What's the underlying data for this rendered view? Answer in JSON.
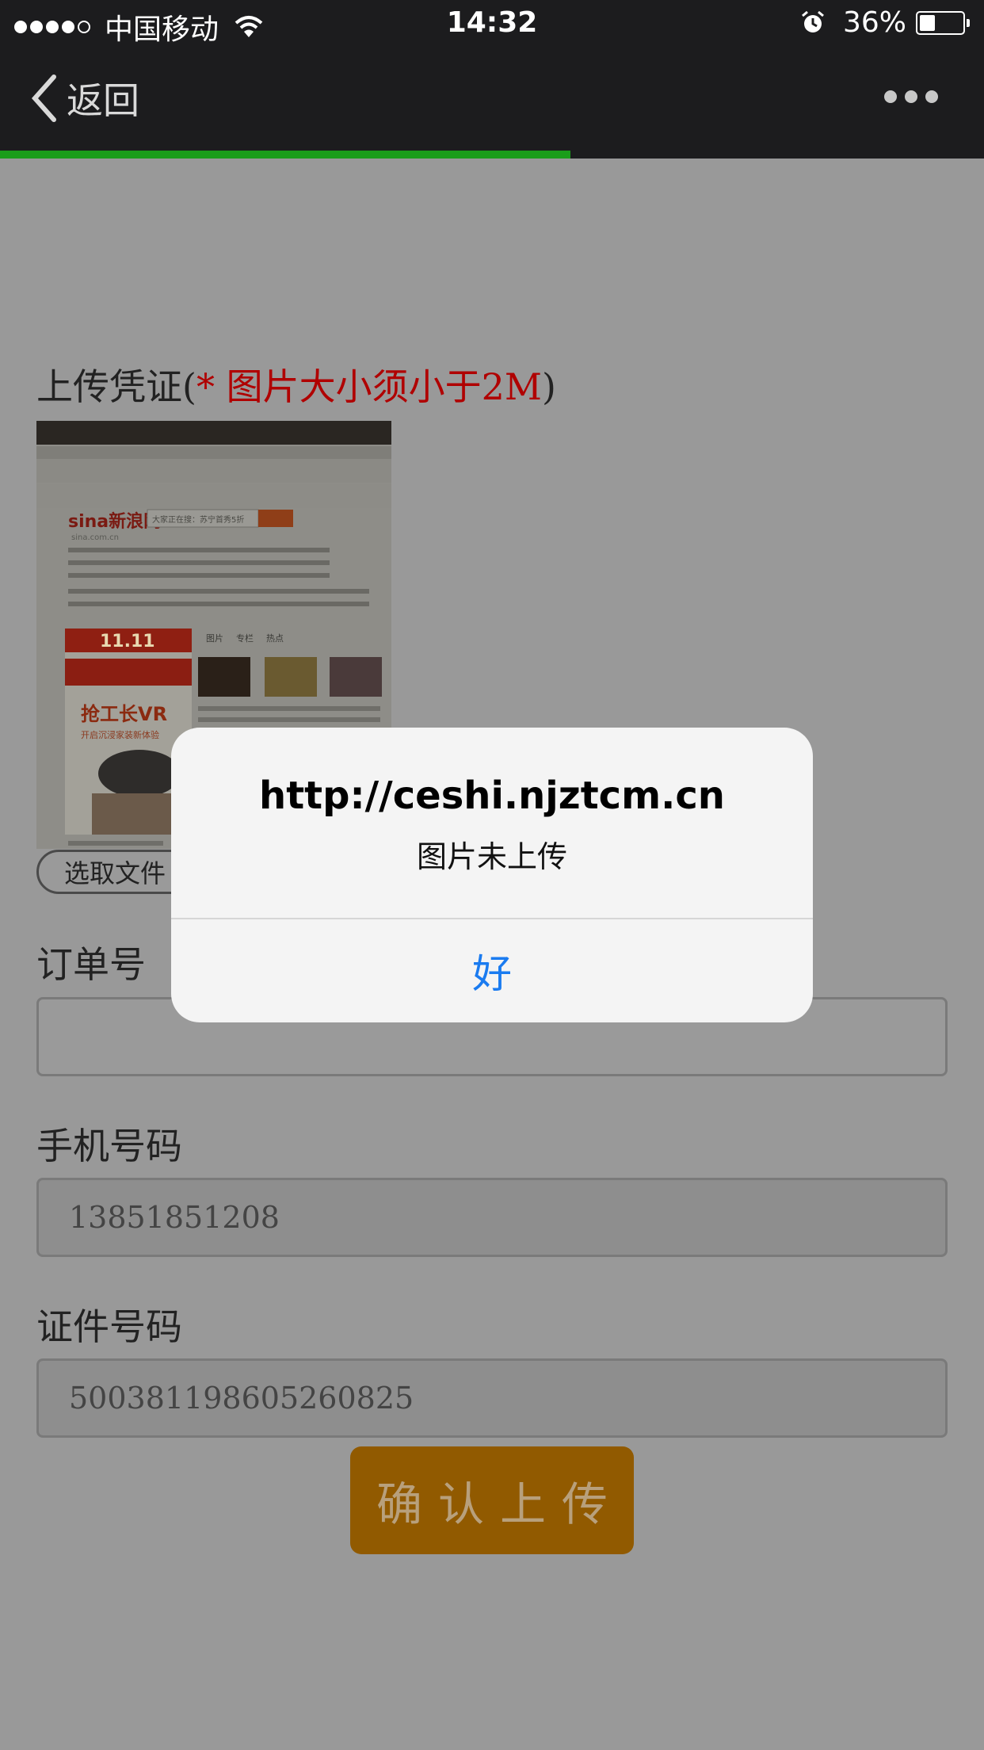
{
  "status_bar": {
    "carrier": "中国移动",
    "time": "14:32",
    "battery": "36%",
    "battery_level": 0.36
  },
  "nav": {
    "back_label": "返回",
    "page_load_progress": 0.58
  },
  "form": {
    "upload_title": "上传凭证(",
    "upload_note": "* 图片大小须小于2M",
    "upload_close": ")",
    "file_button": "选取文件",
    "order_label": "订单号",
    "order_value": "",
    "phone_label": "手机号码",
    "phone_value": "13851851208",
    "id_label": "证件号码",
    "id_value": "500381198605260825",
    "confirm_button": "确认上传"
  },
  "preview": {
    "site_logo": "sina新浪网",
    "site_domain": "sina.com.cn",
    "search_hint": "大家正在搜：苏宁首秀5折",
    "promo_date": "11.11",
    "promo_text": "抢工长VR",
    "promo_sub": "开启沉浸家装新体验",
    "tabs": [
      "图片",
      "专栏",
      "热点"
    ]
  },
  "alert": {
    "title": "http://ceshi.njztcm.cn",
    "message": "图片未上传",
    "ok_label": "好"
  }
}
